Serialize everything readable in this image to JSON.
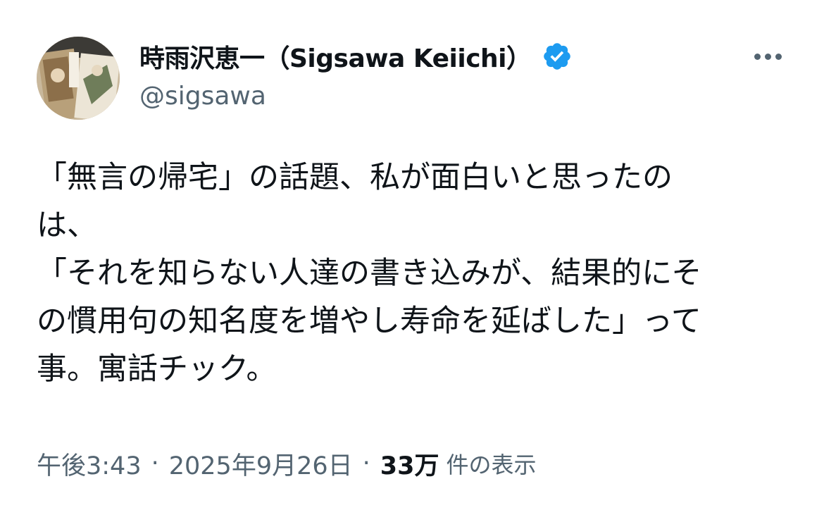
{
  "author": {
    "display_name": "時雨沢恵一（Sigsawa Keiichi）",
    "handle": "@sigsawa",
    "avatar_icon": "book-cover-avatar",
    "verified_icon": "verified-badge-icon",
    "verified_color": "#1d9bf0"
  },
  "more_icon": "more-horizontal-icon",
  "tweet": {
    "lines": [
      "「無言の帰宅」の話題、私が面白いと思ったの",
      "は、",
      "「それを知らない人達の書き込みが、結果的にそ",
      "の慣用句の知名度を増やし寿命を延ばした」って",
      "事。寓話チック。"
    ]
  },
  "meta": {
    "time": "午後3:43",
    "separator": "·",
    "date": "2025年9月26日",
    "views_count": "33万",
    "views_label": "件の表示"
  },
  "colors": {
    "text_primary": "#0f1419",
    "text_secondary": "#536471",
    "accent": "#1d9bf0"
  }
}
